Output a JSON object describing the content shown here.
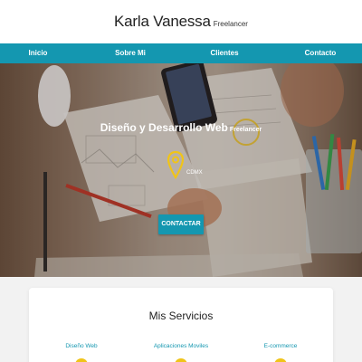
{
  "header": {
    "name": "Karla Vanessa",
    "tagline": "Freelancer"
  },
  "nav": {
    "items": [
      {
        "label": "Inicio"
      },
      {
        "label": "Sobre Mi"
      },
      {
        "label": "Clientes"
      },
      {
        "label": "Contacto"
      }
    ]
  },
  "hero": {
    "title": "Diseño y Desarrollo Web",
    "subtitle": "Freelancer",
    "location": "CDMX",
    "location_icon": "map-pin-icon",
    "cta_label": "CONTACTAR"
  },
  "services": {
    "title": "Mis Servicios",
    "items": [
      {
        "label": "Diseño Web"
      },
      {
        "label": "Aplicaciones Moviles"
      },
      {
        "label": "E-commerce"
      }
    ]
  },
  "colors": {
    "accent": "#1497b0",
    "pin": "#f0c419",
    "header_bg": "#ffffff",
    "page_bg": "#f2f2f2"
  }
}
